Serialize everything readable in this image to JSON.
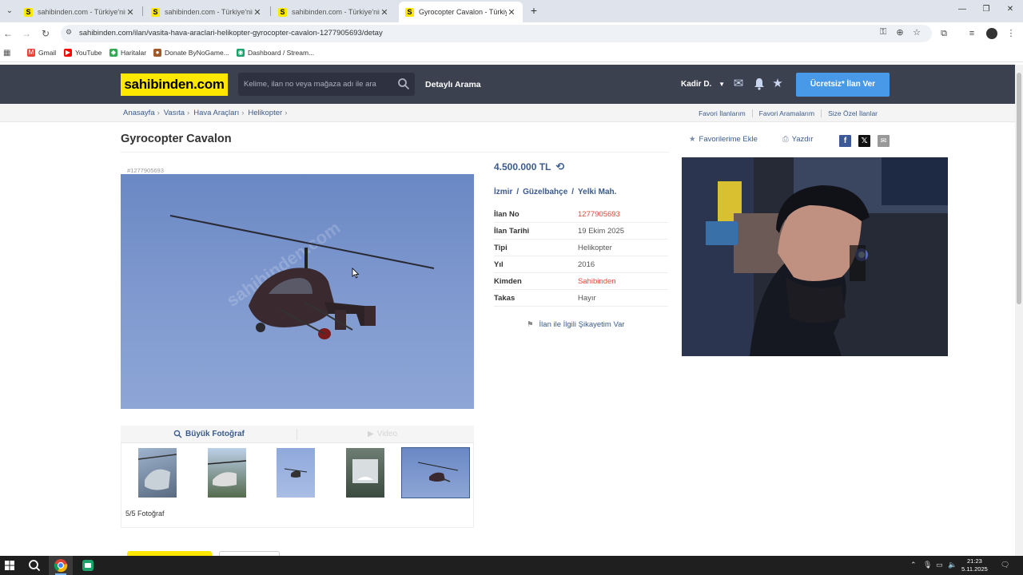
{
  "browser": {
    "tabs": [
      {
        "title": "sahibinden.com - Türkiye'nin O",
        "active": false
      },
      {
        "title": "sahibinden.com - Türkiye'nin O",
        "active": false
      },
      {
        "title": "sahibinden.com - Türkiye'nin O",
        "active": false
      },
      {
        "title": "Gyrocopter Cavalon - Türkiye'",
        "active": true
      }
    ],
    "favicon_letter": "S",
    "new_tab_symbol": "+",
    "url": "sahibinden.com/ilan/vasita-hava-araclari-helikopter-gyrocopter-cavalon-1277905693/detay",
    "bookmarks": [
      {
        "label": "Gmail",
        "icon": "gmail-icon"
      },
      {
        "label": "YouTube",
        "icon": "youtube-icon"
      },
      {
        "label": "Haritalar",
        "icon": "maps-icon"
      },
      {
        "label": "Donate ByNoGame...",
        "icon": "donate-icon"
      },
      {
        "label": "Dashboard / Stream...",
        "icon": "dashboard-icon"
      }
    ]
  },
  "site": {
    "logo": "sahibinden.com",
    "search_placeholder": "Kelime, ilan no veya mağaza adı ile ara",
    "advanced_search": "Detaylı Arama",
    "user": "Kadir D.",
    "cta": "Ücretsiz* İlan Ver",
    "breadcrumb": [
      "Anasayfa",
      "Vasıta",
      "Hava Araçları",
      "Helikopter"
    ],
    "toplinks": [
      "Favori İlanlarım",
      "Favori Aramalarım",
      "Size Özel İlanlar"
    ]
  },
  "listing": {
    "title": "Gyrocopter Cavalon",
    "favorite_label": "Favorilerime Ekle",
    "print_label": "Yazdır",
    "ad_number_tag": "#1277905693",
    "watermark": "sahibinden.com",
    "price": "4.500.000 TL",
    "location": [
      "İzmir",
      "Güzelbahçe",
      "Yelki Mah."
    ],
    "details": [
      {
        "label": "İlan No",
        "value": "1277905693",
        "highlight": true
      },
      {
        "label": "İlan Tarihi",
        "value": "19 Ekim 2025",
        "highlight": false
      },
      {
        "label": "Tipi",
        "value": "Helikopter",
        "highlight": false
      },
      {
        "label": "Yıl",
        "value": "2016",
        "highlight": false
      },
      {
        "label": "Kimden",
        "value": "Sahibinden",
        "highlight": true
      },
      {
        "label": "Takas",
        "value": "Hayır",
        "highlight": false
      }
    ],
    "complaint": "İlan ile İlgili Şikayetim Var",
    "big_photo": "Büyük Fotoğraf",
    "video": "Video",
    "photo_count": "5/5 Fotoğraf"
  },
  "taskbar": {
    "time": "21:23",
    "date": "5.11.2025"
  },
  "colors": {
    "header_bg": "#3c4150",
    "logo_yellow": "#ffe800",
    "cta_blue": "#489ae9",
    "link_blue": "#3b5b8c",
    "highlight_red": "#e2473b"
  }
}
